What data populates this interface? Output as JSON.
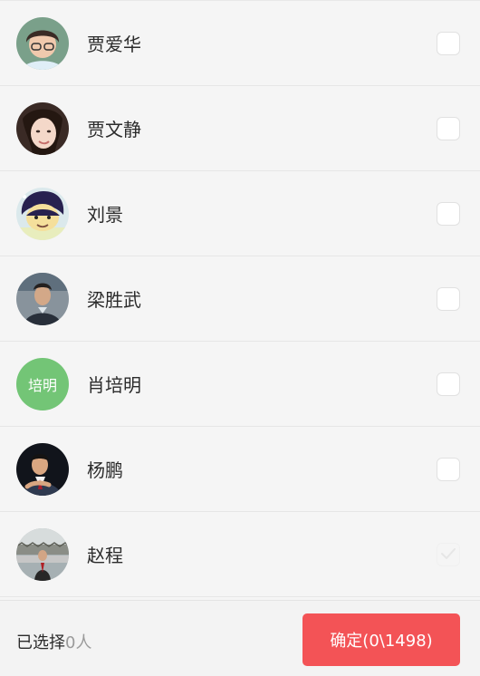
{
  "contacts": [
    {
      "name": "贾爱华",
      "avatar": "photo-avatar",
      "checked": false
    },
    {
      "name": "贾文静",
      "avatar": "photo-avatar",
      "checked": false
    },
    {
      "name": "刘景",
      "avatar": "cartoon-avatar",
      "checked": false
    },
    {
      "name": "梁胜武",
      "avatar": "photo-avatar",
      "checked": false
    },
    {
      "name": "肖培明",
      "avatar": "initials-avatar",
      "avatar_text": "培明",
      "avatar_color": "#73c576",
      "checked": false
    },
    {
      "name": "杨鹏",
      "avatar": "photo-avatar",
      "checked": false
    },
    {
      "name": "赵程",
      "avatar": "photo-avatar",
      "checked": true
    }
  ],
  "footer": {
    "selected_label": "已选择",
    "selected_count": "0人",
    "confirm_label": "确定(0\\1498)"
  },
  "colors": {
    "background": "#f5f5f5",
    "accent": "#f35356",
    "initials_avatar": "#73c576"
  }
}
